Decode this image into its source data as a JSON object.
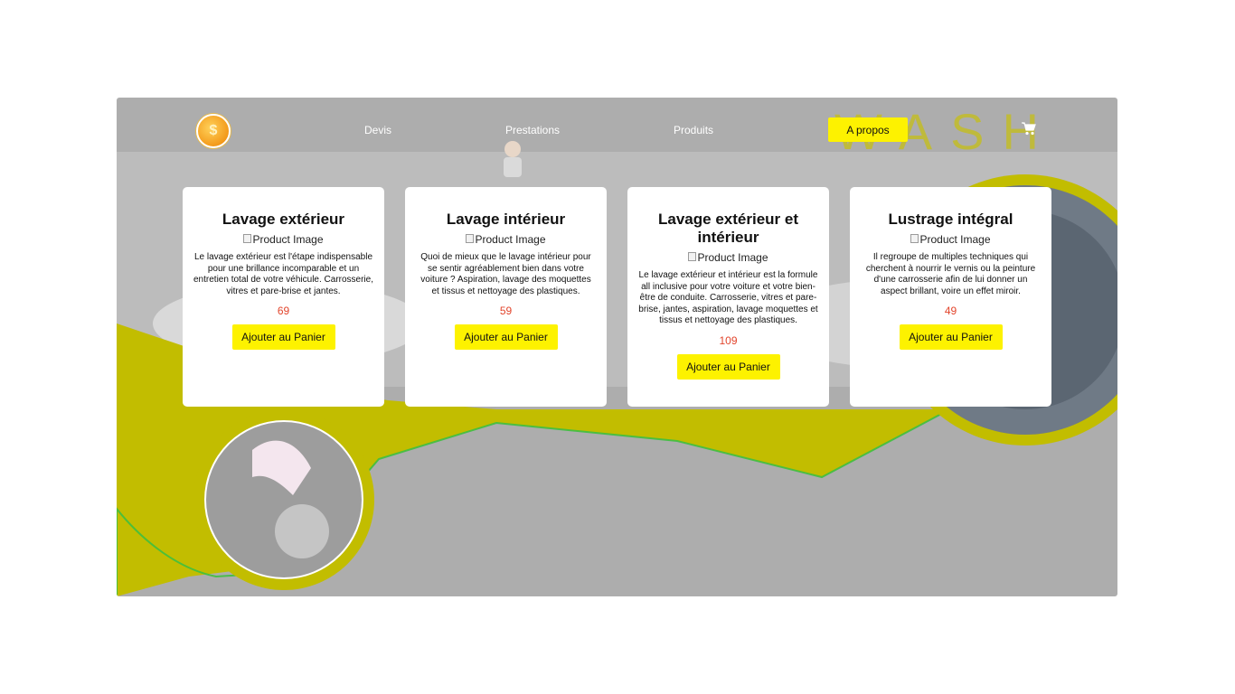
{
  "colors": {
    "accent_yellow": "#fdf200",
    "olive_band": "#c2bd00",
    "background_gray": "#adadad",
    "price_red": "#e2452c"
  },
  "header": {
    "logo_icon": "coin-logo-icon",
    "logo_glyph": "$",
    "nav": {
      "devis": "Devis",
      "prestations": "Prestations",
      "produits": "Produits",
      "apropos": "A propos"
    },
    "brand_watermark": "WASH",
    "cart_icon": "shopping-cart-icon"
  },
  "products": [
    {
      "title": "Lavage extérieur",
      "image_alt": "Product Image",
      "description": "Le lavage extérieur est l'étape indispensable pour une brillance incomparable et un entretien total de votre véhicule. Carrosserie, vitres et pare-brise et jantes.",
      "price": "69",
      "button": "Ajouter au Panier"
    },
    {
      "title": "Lavage intérieur",
      "image_alt": "Product Image",
      "description": "Quoi de mieux que le lavage intérieur pour se sentir agréablement bien dans votre voiture ? Aspiration, lavage des moquettes et tissus et nettoyage des plastiques.",
      "price": "59",
      "button": "Ajouter au Panier"
    },
    {
      "title": "Lavage extérieur et intérieur",
      "image_alt": "Product Image",
      "description": "Le lavage extérieur et intérieur est la formule all inclusive pour votre voiture et votre bien-être de conduite. Carrosserie, vitres et pare-brise, jantes, aspiration, lavage moquettes et tissus et nettoyage des plastiques.",
      "price": "109",
      "button": "Ajouter au Panier"
    },
    {
      "title": "Lustrage intégral",
      "image_alt": "Product Image",
      "description": "Il regroupe de multiples techniques qui cherchent à nourrir le vernis ou la peinture d'une carrosserie afin de lui donner un aspect brillant, voire un effet miroir.",
      "price": "49",
      "button": "Ajouter au Panier"
    }
  ]
}
